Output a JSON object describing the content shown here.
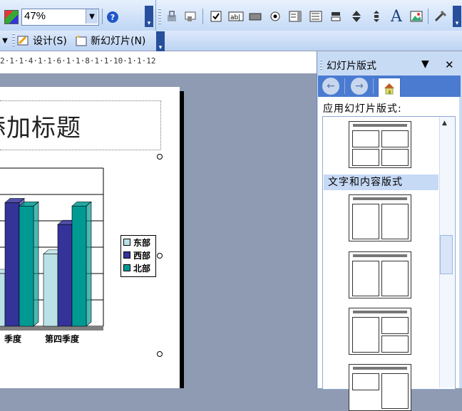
{
  "toolbar": {
    "zoom_value": "47%",
    "design_label": "设计(S)",
    "new_slide_label": "新幻灯片(N)",
    "help_glyph": "?",
    "text_glyph": "A",
    "icons": [
      "color-icon",
      "zoom-dropdown-icon",
      "help-icon",
      "toolbar-options-icon",
      "lock-icon",
      "property-icon",
      "checkbox-icon",
      "textbox-icon",
      "button-icon",
      "radio-icon",
      "listbox-icon",
      "combobox-icon",
      "toggle-icon",
      "spin-icon",
      "scrollbar-icon",
      "label-icon",
      "image-icon",
      "more-controls-icon",
      "design-icon",
      "new-slide-icon"
    ]
  },
  "ruler": {
    "text": "2·1·1·4·1·1·6·1·1·8·1·1·10·1·1·12"
  },
  "slide": {
    "title": "添加标题"
  },
  "chart_data": {
    "type": "bar",
    "categories": [
      "第三季度",
      "第四季度"
    ],
    "category_labels_visible": [
      "季度",
      "第四季度"
    ],
    "series": [
      {
        "name": "东部",
        "color": "#b9e1e6",
        "values": [
          20,
          27.4
        ]
      },
      {
        "name": "西部",
        "color": "#33339a",
        "values": [
          46.9,
          38.6
        ]
      },
      {
        "name": "北部",
        "color": "#009a93",
        "values": [
          45.6,
          45.6
        ]
      }
    ],
    "legend_position": "right",
    "grid": true
  },
  "pane": {
    "title": "幻灯片版式",
    "close_glyph": "✕",
    "menu_glyph": "▼",
    "apply_label": "应用幻灯片版式:",
    "section_label": "文字和内容版式",
    "layouts": [
      "标题和四项内容",
      "标题，文本与内容",
      "标题，内容与文本",
      "标题，文本与两项内容",
      "标题，两项内容与文本"
    ]
  },
  "colors": {
    "toolbar_top": "#e8f1fd",
    "toolbar_bottom": "#c4daf7",
    "pane_header": "#4a7bd0",
    "workspace": "#8f9bb3",
    "section_highlight": "#c6d9f5"
  }
}
